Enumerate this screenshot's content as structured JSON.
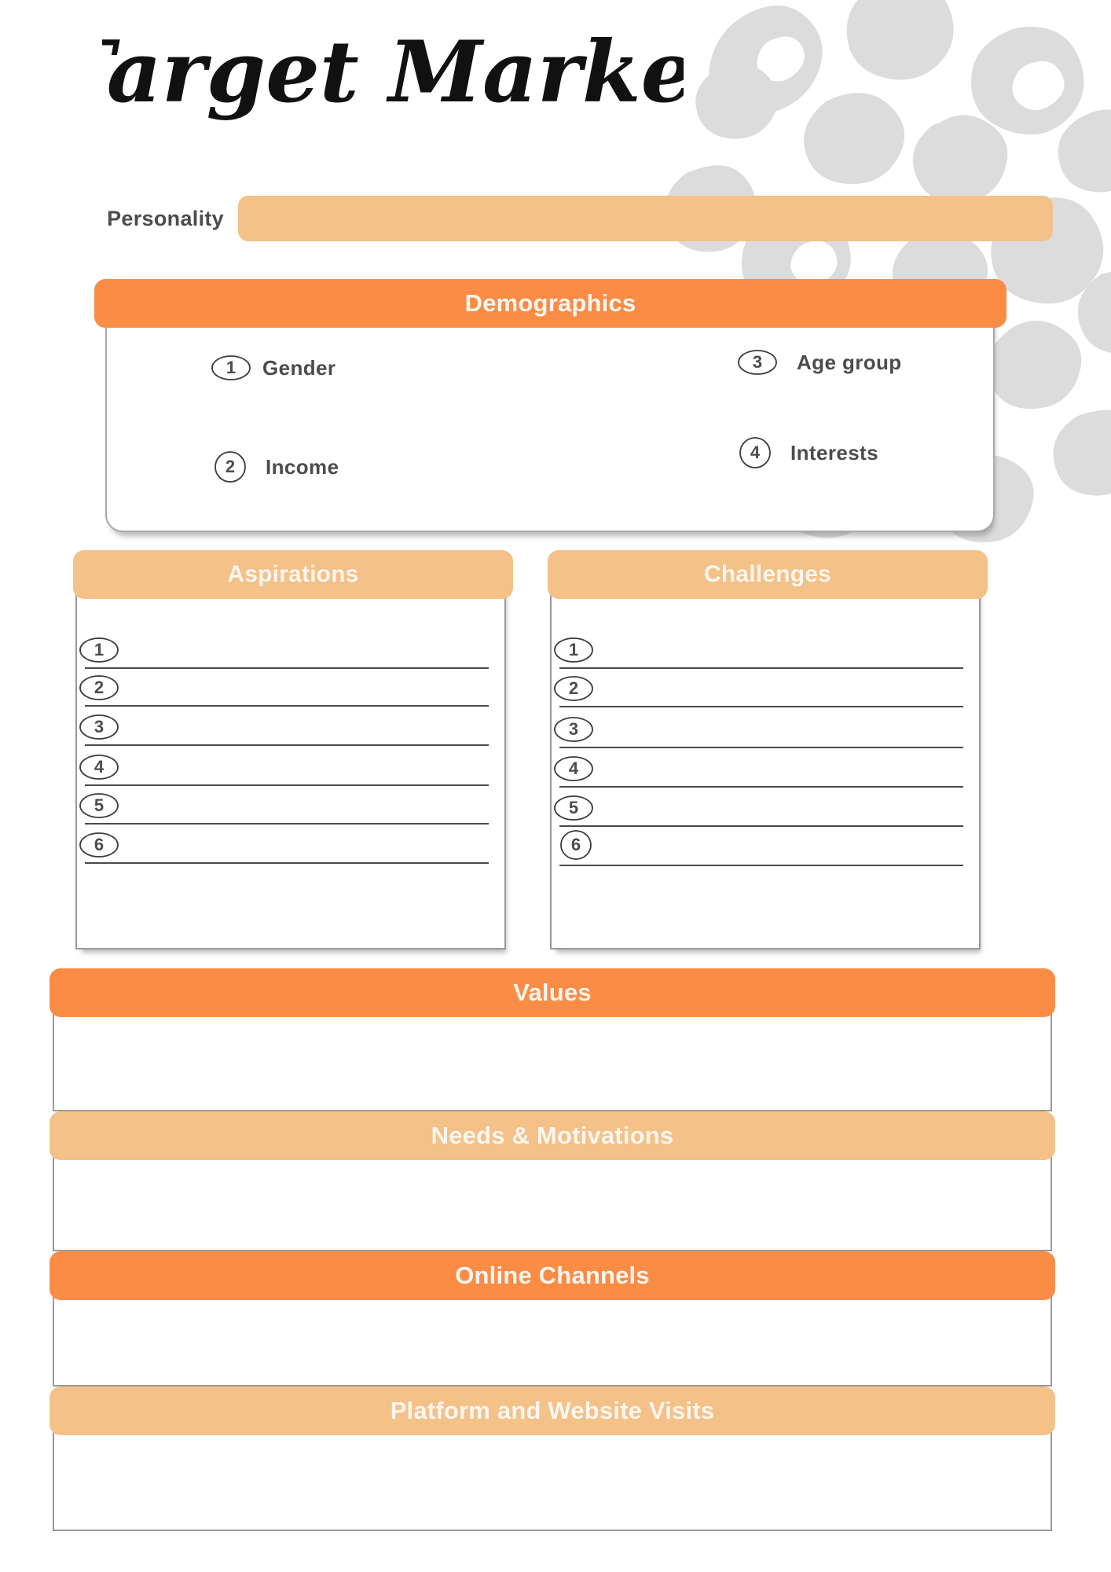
{
  "page": {
    "title": "Target Market",
    "colors": {
      "orange_dark": "#FA8C46",
      "orange_light": "#F4C189",
      "text_gray": "#4C4C4C",
      "border_gray": "#9A9A9A",
      "pattern_gray": "#DCDCDC",
      "bar_text": "#FAF6EF"
    }
  },
  "personality": {
    "label": "Personality",
    "value": ""
  },
  "demographics": {
    "header": "Demographics",
    "items": [
      {
        "number": "1",
        "label": "Gender",
        "shape": "ellipse"
      },
      {
        "number": "2",
        "label": "Income",
        "shape": "circle"
      },
      {
        "number": "3",
        "label": "Age group",
        "shape": "ellipse"
      },
      {
        "number": "4",
        "label": "Interests",
        "shape": "circle"
      }
    ]
  },
  "columns": [
    {
      "header": "Aspirations",
      "rows": [
        {
          "number": "1",
          "value": ""
        },
        {
          "number": "2",
          "value": ""
        },
        {
          "number": "3",
          "value": ""
        },
        {
          "number": "4",
          "value": ""
        },
        {
          "number": "5",
          "value": ""
        },
        {
          "number": "6",
          "value": ""
        }
      ]
    },
    {
      "header": "Challenges",
      "rows": [
        {
          "number": "1",
          "value": ""
        },
        {
          "number": "2",
          "value": ""
        },
        {
          "number": "3",
          "value": ""
        },
        {
          "number": "4",
          "value": ""
        },
        {
          "number": "5",
          "value": ""
        },
        {
          "number": "6",
          "value": ""
        }
      ]
    }
  ],
  "sections": [
    {
      "header": "Values",
      "value": "",
      "tone": "dark"
    },
    {
      "header": "Needs & Motivations",
      "value": "",
      "tone": "light"
    },
    {
      "header": "Online Channels",
      "value": "",
      "tone": "dark"
    },
    {
      "header": "Platform and Website Visits",
      "value": "",
      "tone": "light"
    }
  ]
}
